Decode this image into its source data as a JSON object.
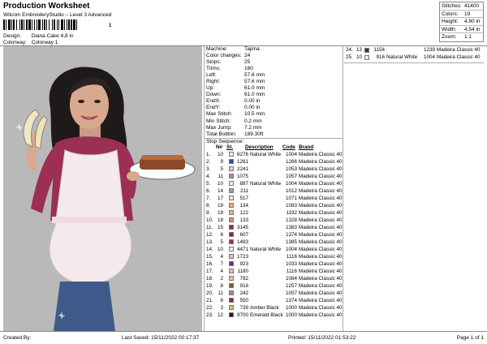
{
  "header": {
    "title": "Production Worksheet",
    "subtitle": "Wilcom EmbroideryStudio – Level 3 Advanced",
    "barcode_tail": "1",
    "meta": [
      {
        "label": "Design:",
        "value": "Diana Cake 4,8 in"
      },
      {
        "label": "Colorway:",
        "value": "Colorway 1"
      }
    ]
  },
  "stats": [
    {
      "label": "Stitches:",
      "value": "41400"
    },
    {
      "label": "Colors:",
      "value": "19"
    },
    {
      "label": "Height:",
      "value": "4.80 in"
    },
    {
      "label": "Width:",
      "value": "4.54 in"
    },
    {
      "label": "Zoom:",
      "value": "1:1"
    }
  ],
  "machine_info": [
    {
      "label": "Machine:",
      "value": "Tajima"
    },
    {
      "label": "Color changes:",
      "value": "24"
    },
    {
      "label": "Stops:",
      "value": "25"
    },
    {
      "label": "Trims:",
      "value": "160"
    },
    {
      "label": "Left:",
      "value": "57.6 mm"
    },
    {
      "label": "Right:",
      "value": "57.6 mm"
    },
    {
      "label": "Up:",
      "value": "61.0 mm"
    },
    {
      "label": "Down:",
      "value": "61.0 mm"
    },
    {
      "label": "EndX:",
      "value": "0.00 in"
    },
    {
      "label": "EndY:",
      "value": "0.00 in"
    },
    {
      "label": "Max Stitch:",
      "value": "10.5 mm"
    },
    {
      "label": "Min Stitch:",
      "value": "0.2 mm"
    },
    {
      "label": "Max Jump:",
      "value": "7.2 mm"
    },
    {
      "label": "Total Bobbin:",
      "value": "189.30ft"
    }
  ],
  "stop_sequence": {
    "title": "Stop Sequence:",
    "headers": {
      "n": "N#",
      "st": "St.",
      "description": "Description",
      "code": "Code",
      "brand": "Brand"
    },
    "rows": [
      {
        "idx": "1.",
        "n": "10",
        "color": "#f2eeea",
        "st": "6276",
        "desc": "Natural White",
        "code": "1004",
        "brand": "Madeira Classic 40"
      },
      {
        "idx": "2.",
        "n": "9",
        "color": "#2a4fa0",
        "st": "1261",
        "desc": "",
        "code": "1266",
        "brand": "Madeira Classic 40"
      },
      {
        "idx": "3.",
        "n": "5",
        "color": "#e7c9c2",
        "st": "2241",
        "desc": "",
        "code": "1053",
        "brand": "Madeira Classic 40"
      },
      {
        "idx": "4.",
        "n": "11",
        "color": "#b28a7d",
        "st": "1075",
        "desc": "",
        "code": "1057",
        "brand": "Madeira Classic 40"
      },
      {
        "idx": "5.",
        "n": "10",
        "color": "#f2eeea",
        "st": "887",
        "desc": "Natural White",
        "code": "1004",
        "brand": "Madeira Classic 40"
      },
      {
        "idx": "6.",
        "n": "14",
        "color": "#a89d95",
        "st": "211",
        "desc": "",
        "code": "1012",
        "brand": "Madeira Classic 40"
      },
      {
        "idx": "7.",
        "n": "17",
        "color": "#e6e3df",
        "st": "517",
        "desc": "",
        "code": "1071",
        "brand": "Madeira Classic 40"
      },
      {
        "idx": "8.",
        "n": "18",
        "color": "#e8b57c",
        "st": "134",
        "desc": "",
        "code": "1083",
        "brand": "Madeira Classic 40"
      },
      {
        "idx": "9.",
        "n": "19",
        "color": "#d6c084",
        "st": "122",
        "desc": "",
        "code": "1192",
        "brand": "Madeira Classic 40"
      },
      {
        "idx": "10.",
        "n": "18",
        "color": "#cf8a8c",
        "st": "133",
        "desc": "",
        "code": "1328",
        "brand": "Madeira Classic 40"
      },
      {
        "idx": "11.",
        "n": "15",
        "color": "#8a2a4c",
        "st": "3145",
        "desc": "",
        "code": "1383",
        "brand": "Madeira Classic 40"
      },
      {
        "idx": "12.",
        "n": "6",
        "color": "#7a2e3a",
        "st": "607",
        "desc": "",
        "code": "1374",
        "brand": "Madeira Classic 40"
      },
      {
        "idx": "13.",
        "n": "5",
        "color": "#a1305f",
        "st": "1493",
        "desc": "",
        "code": "1385",
        "brand": "Madeira Classic 40"
      },
      {
        "idx": "14.",
        "n": "10",
        "color": "#f2eeea",
        "st": "4471",
        "desc": "Natural White",
        "code": "1004",
        "brand": "Madeira Classic 40"
      },
      {
        "idx": "15.",
        "n": "4",
        "color": "#e9b9c5",
        "st": "1723",
        "desc": "",
        "code": "1116",
        "brand": "Madeira Classic 40"
      },
      {
        "idx": "16.",
        "n": "7",
        "color": "#6b2a7e",
        "st": "923",
        "desc": "",
        "code": "1033",
        "brand": "Madeira Classic 40"
      },
      {
        "idx": "17.",
        "n": "4",
        "color": "#e9b9c5",
        "st": "1180",
        "desc": "",
        "code": "1116",
        "brand": "Madeira Classic 40"
      },
      {
        "idx": "18.",
        "n": "2",
        "color": "#d9c7b6",
        "st": "782",
        "desc": "",
        "code": "1084",
        "brand": "Madeira Classic 40"
      },
      {
        "idx": "19.",
        "n": "8",
        "color": "#8a5a3a",
        "st": "916",
        "desc": "",
        "code": "1257",
        "brand": "Madeira Classic 40"
      },
      {
        "idx": "20.",
        "n": "11",
        "color": "#b28a7d",
        "st": "242",
        "desc": "",
        "code": "1057",
        "brand": "Madeira Classic 40"
      },
      {
        "idx": "21.",
        "n": "6",
        "color": "#7a2e3a",
        "st": "550",
        "desc": "",
        "code": "1374",
        "brand": "Madeira Classic 40"
      },
      {
        "idx": "22.",
        "n": "3",
        "color": "#e2c15a",
        "st": "739",
        "desc": "Amber Black",
        "code": "1000",
        "brand": "Madeira Classic 40"
      },
      {
        "idx": "23.",
        "n": "12",
        "color": "#1a1a1a",
        "st": "9700",
        "desc": "Emerald Black",
        "code": "1000",
        "brand": "Madeira Classic 40"
      }
    ],
    "continued": [
      {
        "idx": "24.",
        "n": "13",
        "color": "#3a3a3a",
        "st": "1154",
        "desc": "",
        "code": "1239",
        "brand": "Madeira Classic 40"
      },
      {
        "idx": "25.",
        "n": "10",
        "color": "#f2eeea",
        "st": "916",
        "desc": "Natural White",
        "code": "1004",
        "brand": "Madeira Classic 40"
      }
    ]
  },
  "footer": {
    "created_by": "Created By:",
    "last_saved": "Last Saved:  15/11/2022 00:17:37",
    "printed": "Printed:  15/11/2022 01:53:22",
    "page": "Page 1 of 1"
  },
  "design_preview": {
    "background": "#b9b9b9",
    "subject": "embroidery design preview"
  }
}
